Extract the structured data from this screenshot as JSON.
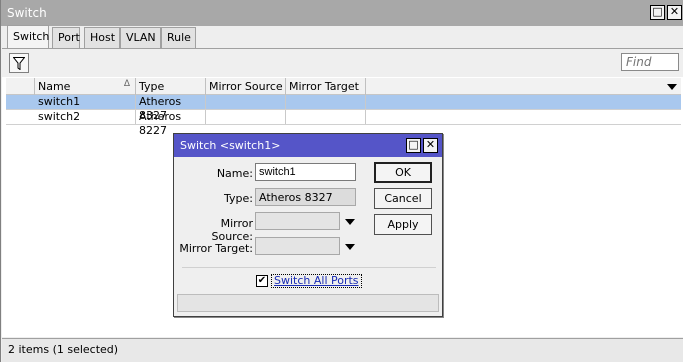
{
  "window": {
    "title": "Switch",
    "restore_glyph": "□",
    "close_glyph": "✕"
  },
  "tabs": [
    {
      "label": "Switch",
      "active": true
    },
    {
      "label": "Port",
      "active": false
    },
    {
      "label": "Host",
      "active": false
    },
    {
      "label": "VLAN",
      "active": false
    },
    {
      "label": "Rule",
      "active": false
    }
  ],
  "toolbar": {
    "filter_icon": "filter-icon",
    "find_placeholder": "Find"
  },
  "table": {
    "columns": [
      "Name",
      "Type",
      "Mirror Source",
      "Mirror Target"
    ],
    "sort_indicator": "Δ",
    "rows": [
      {
        "name": "switch1",
        "type": "Atheros 8327",
        "mirror_source": "",
        "mirror_target": "",
        "selected": true
      },
      {
        "name": "switch2",
        "type": "Atheros 8227",
        "mirror_source": "",
        "mirror_target": "",
        "selected": false
      }
    ]
  },
  "status": {
    "text": "2 items (1 selected)"
  },
  "dialog": {
    "title": "Switch <switch1>",
    "fields": {
      "name_label": "Name:",
      "name_value": "switch1",
      "type_label": "Type:",
      "type_value": "Atheros 8327",
      "mirror_source_label": "Mirror Source:",
      "mirror_source_value": "",
      "mirror_target_label": "Mirror Target:",
      "mirror_target_value": ""
    },
    "buttons": {
      "ok": "OK",
      "cancel": "Cancel",
      "apply": "Apply"
    },
    "checkbox": {
      "label": "Switch All Ports",
      "checked": true,
      "mark": "✔"
    },
    "accent_color": "#5555c8"
  }
}
